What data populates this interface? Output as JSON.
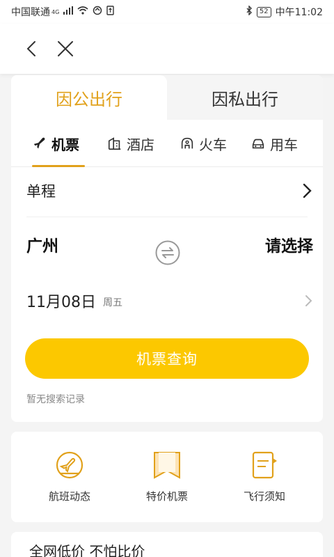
{
  "status_bar": {
    "carrier": "中国联通",
    "network": "4G",
    "battery": "52",
    "time": "中午11:02"
  },
  "nav": {
    "back_icon": "chevron-left-icon",
    "close_icon": "close-icon"
  },
  "travel_tabs": {
    "business": "因公出行",
    "personal": "因私出行",
    "active_color": "#e1a11b"
  },
  "mode_tabs": [
    {
      "label": "机票",
      "icon": "airplane-icon"
    },
    {
      "label": "酒店",
      "icon": "hotel-icon"
    },
    {
      "label": "火车",
      "icon": "train-icon"
    },
    {
      "label": "用车",
      "icon": "car-icon"
    }
  ],
  "trip": {
    "type": "单程"
  },
  "route": {
    "from": "广州",
    "to": "请选择"
  },
  "date": {
    "value": "11月08日",
    "weekday": "周五"
  },
  "search": {
    "button_label": "机票查询",
    "button_color": "#fcc800",
    "no_history": "暂无搜索记录"
  },
  "services": [
    {
      "label": "航班动态",
      "icon": "flight-status-icon"
    },
    {
      "label": "特价机票",
      "icon": "bookmark-icon"
    },
    {
      "label": "飞行须知",
      "icon": "notebook-icon"
    }
  ],
  "promo": {
    "title": "全网低价 不怕比价"
  }
}
